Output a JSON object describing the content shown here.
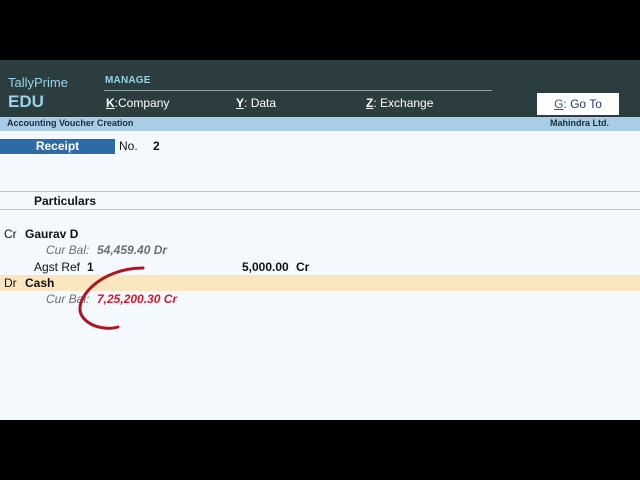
{
  "header": {
    "brand_line1": "TallyPrime",
    "brand_line2": "EDU",
    "section_label": "MANAGE",
    "menu": [
      {
        "key": "K",
        "label": "Company"
      },
      {
        "key": "Y",
        "label": "Data"
      },
      {
        "key": "Z",
        "label": "Exchange"
      }
    ],
    "goto": {
      "key": "G",
      "label": "Go To"
    }
  },
  "subbar": {
    "title": "Accounting Voucher Creation",
    "company": "Mahindra Ltd."
  },
  "voucher": {
    "type": "Receipt",
    "no_label": "No.",
    "no_value": "2"
  },
  "table": {
    "header": "Particulars"
  },
  "entries": [
    {
      "drcr": "Cr",
      "ledger": "Gaurav D",
      "cur_bal_label": "Cur Bal:",
      "cur_bal_value": "54,459.40 Dr",
      "agst_ref_label": "Agst Ref",
      "agst_ref_value": "1",
      "amount": "5,000.00",
      "amount_drcr": "Cr"
    },
    {
      "drcr": "Dr",
      "ledger": "Cash",
      "cur_bal_label": "Cur Bal:",
      "cur_bal_value": "7,25,200.30 Cr"
    }
  ],
  "colors": {
    "header_bg": "#2b3d3f",
    "subbar_bg": "#a9cde6",
    "badge_bg": "#2c6aa8",
    "highlight_row": "#fbe7bf",
    "annotation_red": "#b0141f"
  }
}
